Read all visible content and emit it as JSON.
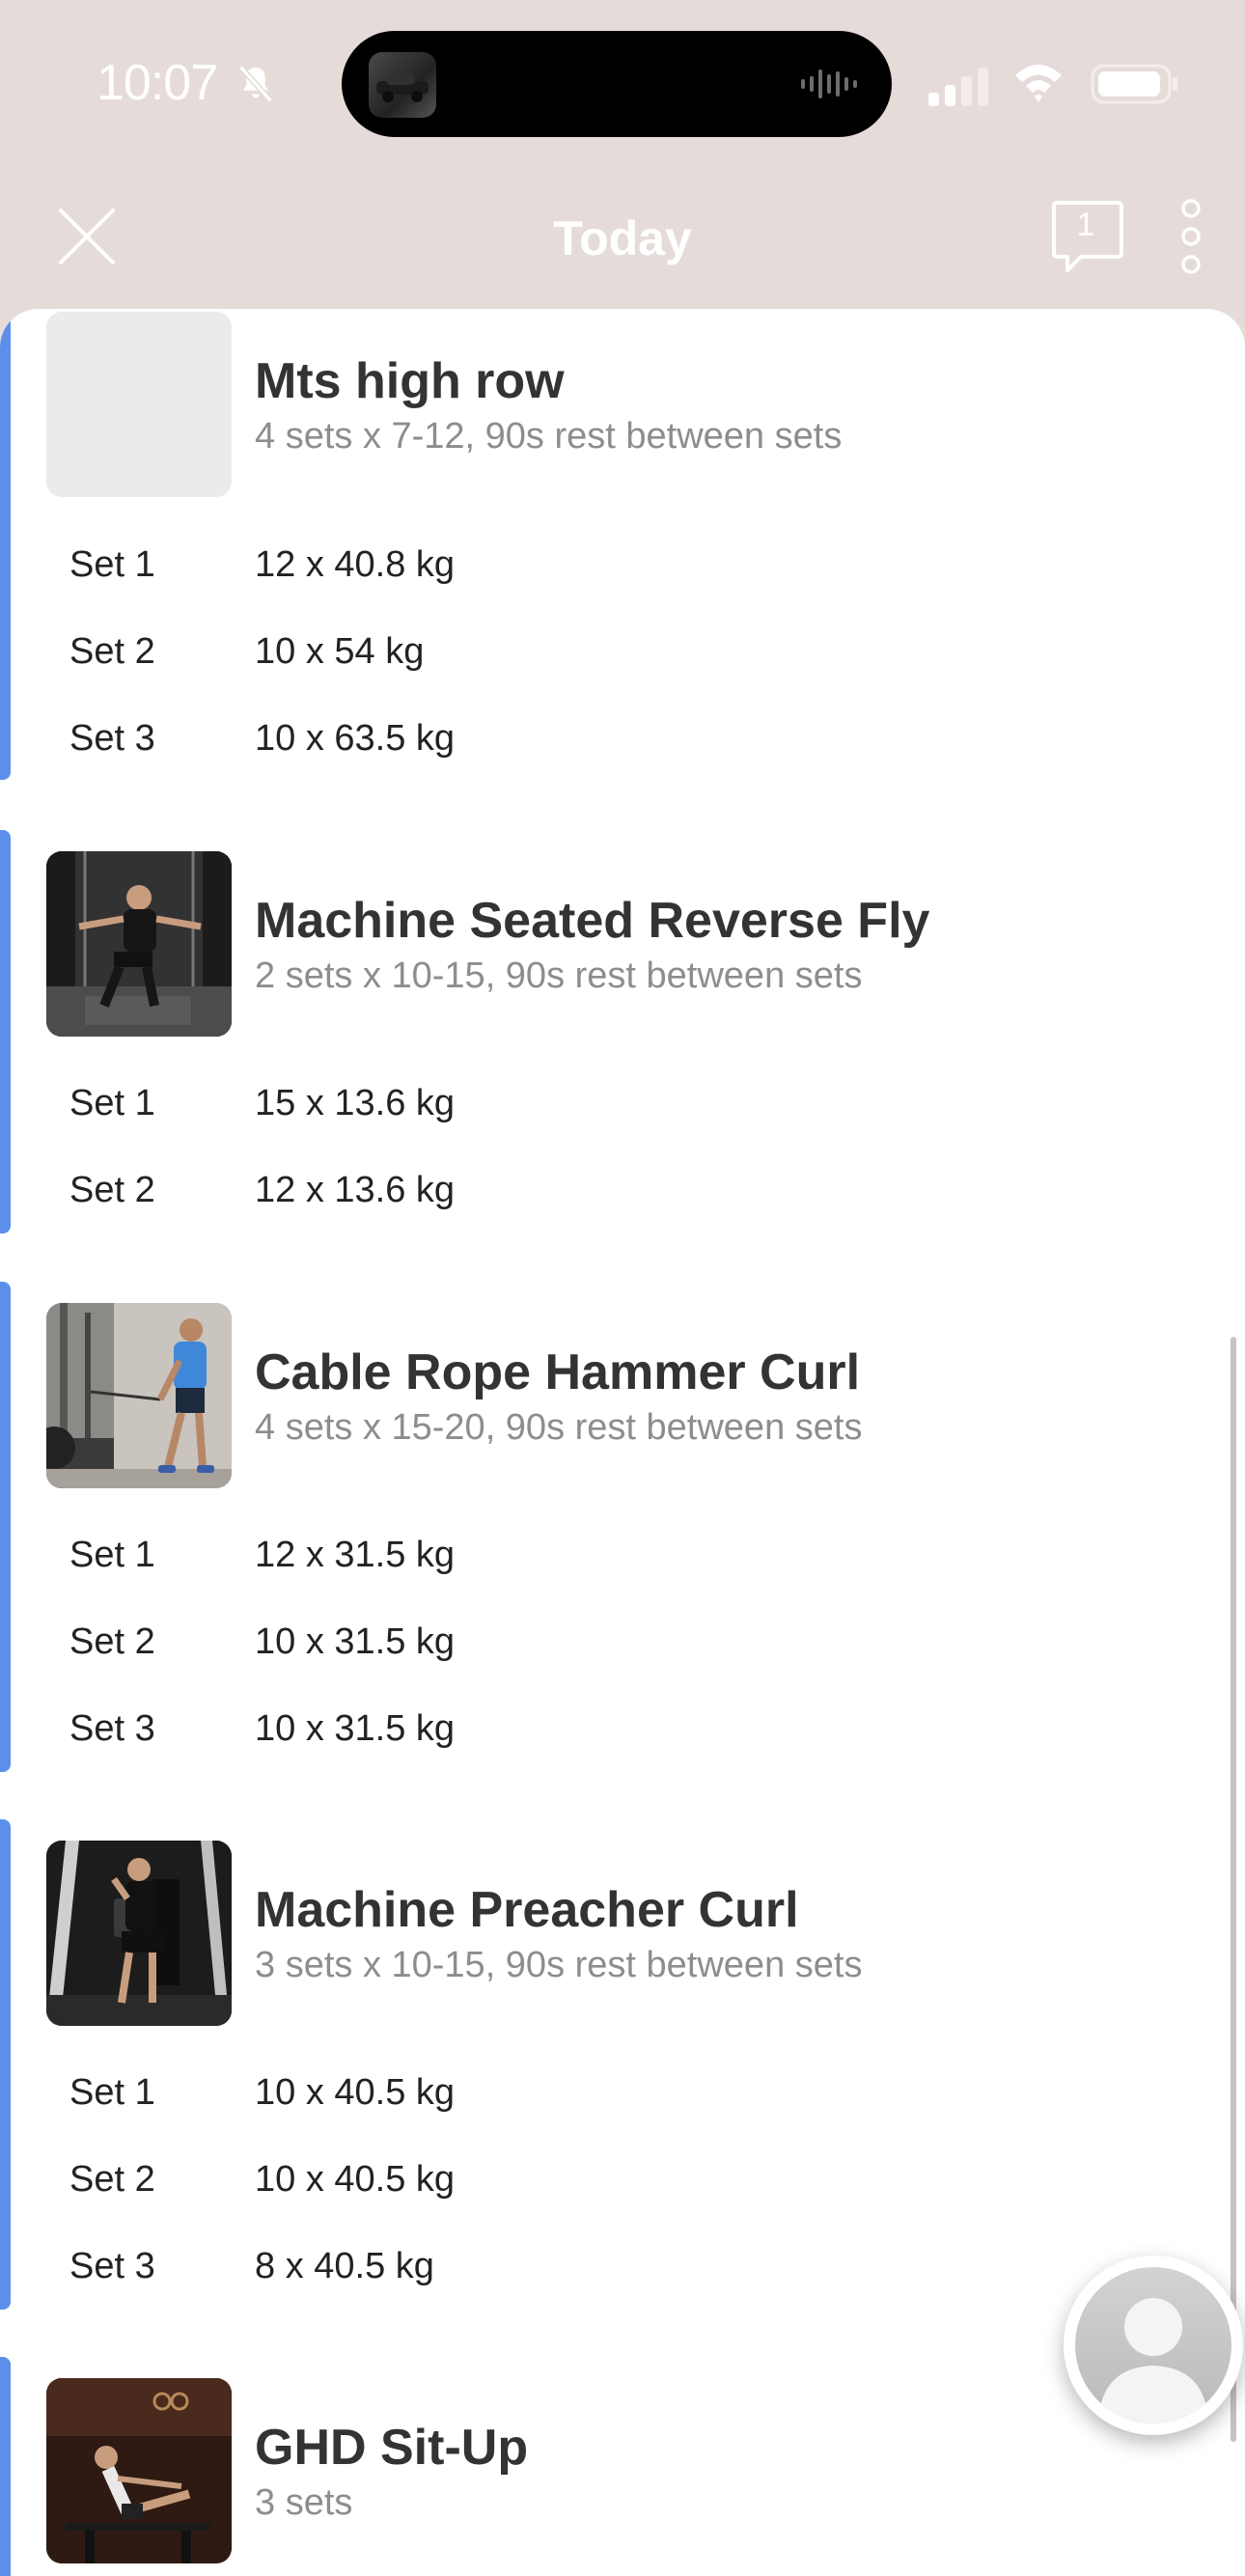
{
  "status_bar": {
    "time": "10:07"
  },
  "header": {
    "title": "Today",
    "comment_count": "1"
  },
  "exercises": [
    {
      "name": "Mts high row",
      "summary": "4 sets x 7-12, 90s rest between sets",
      "image": "placeholder",
      "sets": [
        {
          "label": "Set 1",
          "value": "12 x 40.8 kg"
        },
        {
          "label": "Set 2",
          "value": "10 x 54 kg"
        },
        {
          "label": "Set 3",
          "value": "10 x 63.5 kg"
        }
      ]
    },
    {
      "name": "Machine Seated Reverse Fly",
      "summary": "2 sets x 10-15, 90s rest between sets",
      "image": "gym-photo",
      "sets": [
        {
          "label": "Set 1",
          "value": "15 x 13.6 kg"
        },
        {
          "label": "Set 2",
          "value": "12 x 13.6 kg"
        }
      ]
    },
    {
      "name": "Cable Rope Hammer Curl",
      "summary": "4 sets x 15-20, 90s rest between sets",
      "image": "gym-photo",
      "sets": [
        {
          "label": "Set 1",
          "value": "12 x 31.5 kg"
        },
        {
          "label": "Set 2",
          "value": "10 x 31.5 kg"
        },
        {
          "label": "Set 3",
          "value": "10 x 31.5 kg"
        }
      ]
    },
    {
      "name": "Machine Preacher Curl",
      "summary": "3 sets x 10-15, 90s rest between sets",
      "image": "gym-photo",
      "sets": [
        {
          "label": "Set 1",
          "value": "10 x 40.5 kg"
        },
        {
          "label": "Set 2",
          "value": "10 x 40.5 kg"
        },
        {
          "label": "Set 3",
          "value": "8 x 40.5 kg"
        }
      ]
    },
    {
      "name": "GHD Sit-Up",
      "summary": "3 sets",
      "image": "gym-photo",
      "sets": []
    }
  ],
  "colors": {
    "header_bg": "#e5dcd9",
    "accent": "#5c8fea",
    "primary_text": "#333333",
    "secondary_text": "#8d8d8d"
  }
}
